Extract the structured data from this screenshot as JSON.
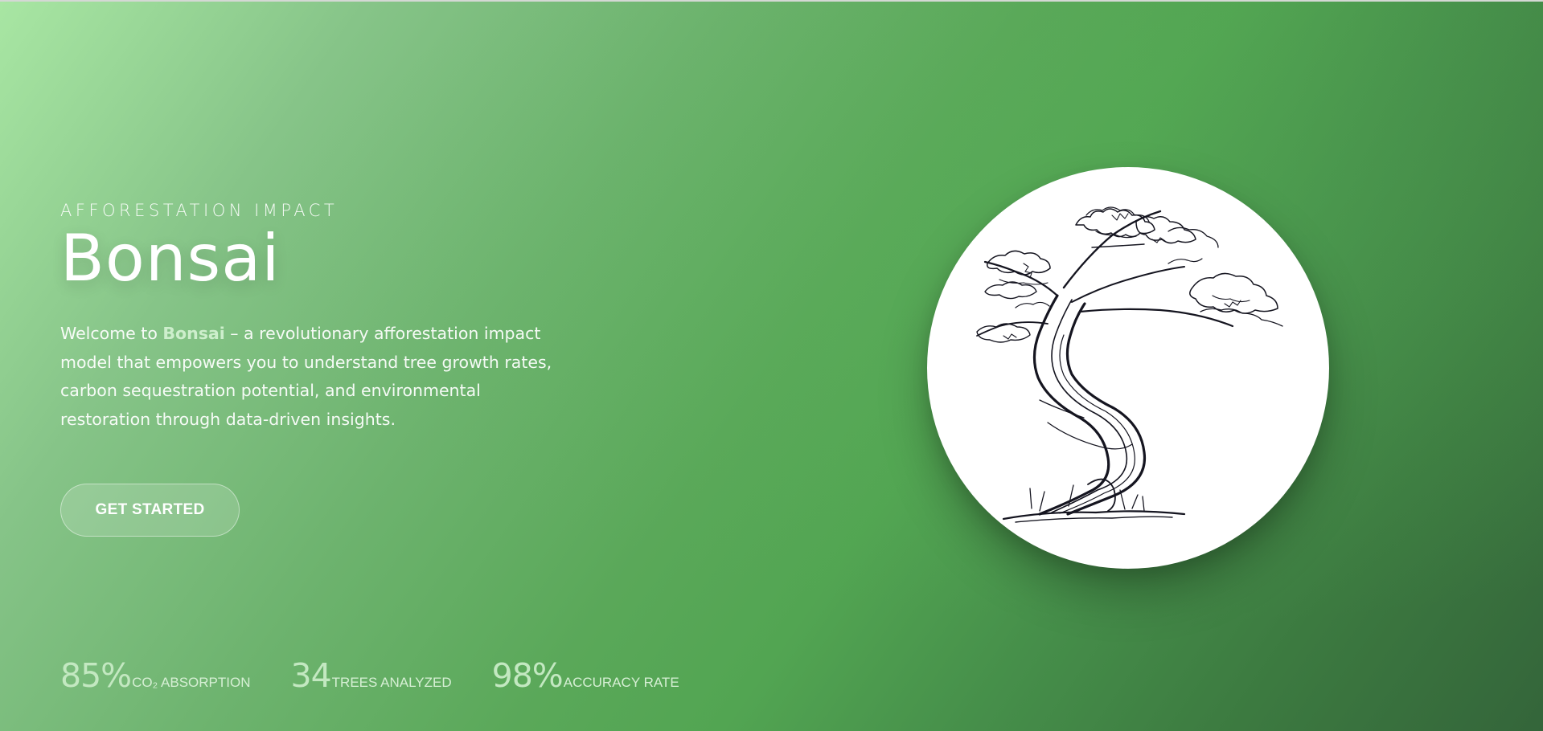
{
  "hero": {
    "eyebrow": "AFFORESTATION IMPACT",
    "title": "Bonsai",
    "description": {
      "prefix": "Welcome to ",
      "brand": "Bonsai",
      "suffix": " – a revolutionary afforestation impact model that empowers you to understand tree growth rates, carbon sequestration potential, and environmental restoration through data-driven insights."
    },
    "cta_label": "GET STARTED"
  },
  "stats": [
    {
      "value": "85%",
      "label": "CO₂ ABSORPTION"
    },
    {
      "value": "34",
      "label": "TREES ANALYZED"
    },
    {
      "value": "98%",
      "label": "ACCURACY RATE"
    }
  ],
  "illustration": {
    "icon": "bonsai-tree-sketch-icon"
  },
  "colors": {
    "gradient_start": "#a8e6a3",
    "gradient_mid": "#5aa859",
    "gradient_end": "#34653a",
    "accent_text": "#c3e8c1"
  }
}
